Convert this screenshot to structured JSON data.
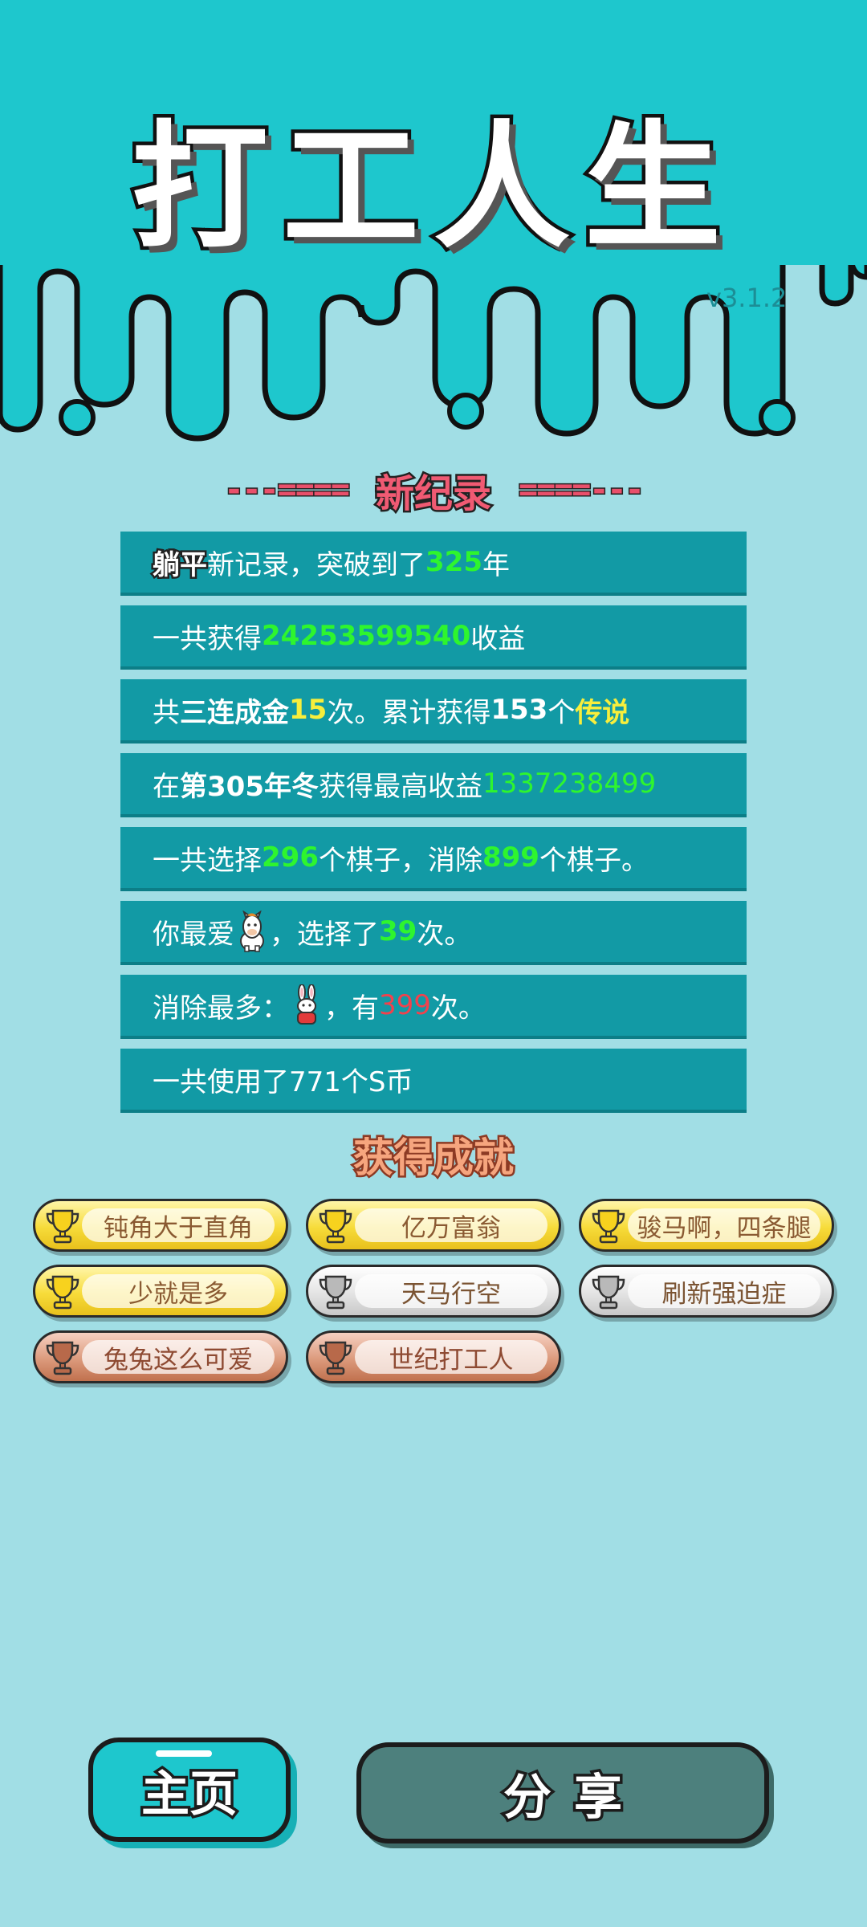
{
  "header": {
    "title": "打工人生",
    "version": "v3.1.2"
  },
  "record": {
    "deco_left": "---====",
    "title": "新纪录",
    "deco_right": "====---"
  },
  "stats": [
    {
      "parts": [
        "躺平",
        "新记录，突破到了",
        "325",
        "年"
      ]
    },
    {
      "parts": [
        "一共获得",
        "24253599540",
        "收益"
      ]
    },
    {
      "parts": [
        "共",
        "三连成金",
        "15",
        "次。累计获得",
        "153",
        "个",
        "传说"
      ]
    },
    {
      "parts": [
        "在 ",
        "第305年冬",
        " 获得最高收益",
        "1337238499"
      ]
    },
    {
      "parts": [
        "一共选择",
        "296",
        "个棋子，消除",
        "899",
        "个棋子。"
      ]
    },
    {
      "parts": [
        "你最爱",
        "，选择了",
        "39",
        "次。"
      ]
    },
    {
      "parts": [
        "消除最多：",
        "，有",
        "399",
        "次。"
      ]
    },
    {
      "parts": [
        "一共使用了771个S币"
      ]
    }
  ],
  "achievements": {
    "title": "获得成就",
    "items": [
      {
        "label": "钝角大于直角",
        "tier": "gold"
      },
      {
        "label": "亿万富翁",
        "tier": "gold"
      },
      {
        "label": "骏马啊，四条腿",
        "tier": "gold"
      },
      {
        "label": "少就是多",
        "tier": "gold"
      },
      {
        "label": "天马行空",
        "tier": "silver"
      },
      {
        "label": "刷新强迫症",
        "tier": "silver"
      },
      {
        "label": "兔兔这么可爱",
        "tier": "bronze"
      },
      {
        "label": "世纪打工人",
        "tier": "bronze"
      }
    ]
  },
  "buttons": {
    "home": "主页",
    "share": "分享"
  },
  "icons": {
    "favorite": "horse-icon",
    "most_eliminated": "rabbit-icon",
    "achievement": "trophy-icon"
  },
  "colors": {
    "background": "#a1dee5",
    "header": "#1ec7cd",
    "row": "#129aa5",
    "highlight_green": "#2ef52e",
    "highlight_yellow": "#f7ee3c",
    "highlight_red": "#f2414c",
    "record_title": "#f05a73",
    "share_button": "#4d807d"
  }
}
